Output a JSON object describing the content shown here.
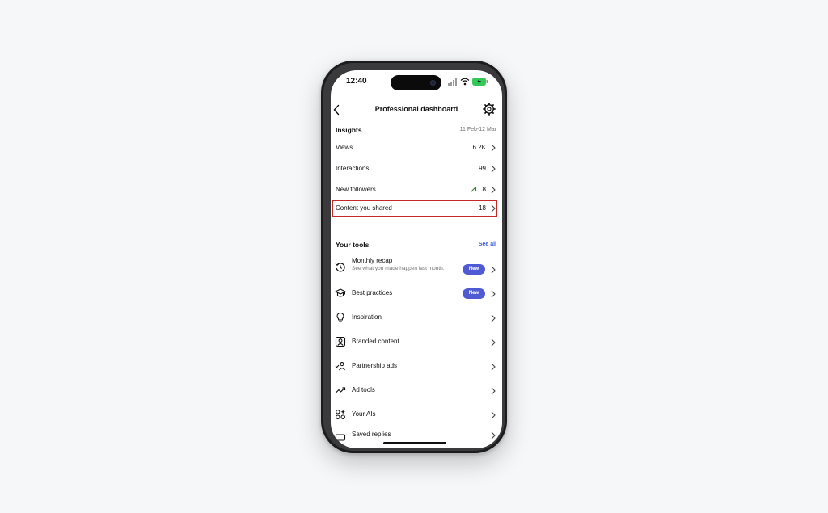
{
  "status_bar": {
    "time": "12:40"
  },
  "header": {
    "title": "Professional dashboard"
  },
  "insights": {
    "title": "Insights",
    "date_range": "11 Feb-12 Mar",
    "rows": [
      {
        "label": "Views",
        "value": "6.2K"
      },
      {
        "label": "Interactions",
        "value": "99"
      },
      {
        "label": "New followers",
        "value": "8"
      },
      {
        "label": "Content you shared",
        "value": "18"
      }
    ]
  },
  "tools": {
    "title": "Your tools",
    "see_all": "See all",
    "items": [
      {
        "label": "Monthly recap",
        "sublabel": "See what you made happen last month.",
        "badge": "New",
        "icon": "history-icon"
      },
      {
        "label": "Best practices",
        "badge": "New",
        "icon": "graduation-cap-icon"
      },
      {
        "label": "Inspiration",
        "icon": "lightbulb-icon"
      },
      {
        "label": "Branded content",
        "icon": "branded-content-icon"
      },
      {
        "label": "Partnership ads",
        "icon": "partnership-icon"
      },
      {
        "label": "Ad tools",
        "icon": "trending-up-icon"
      },
      {
        "label": "Your AIs",
        "icon": "ai-shapes-icon"
      },
      {
        "label": "Saved replies",
        "icon": "saved-replies-icon"
      }
    ]
  },
  "colors": {
    "accent": "#3b5bdb",
    "badge": "#4f5bd5",
    "highlight": "#c62828",
    "trend": "#2e7d32"
  }
}
